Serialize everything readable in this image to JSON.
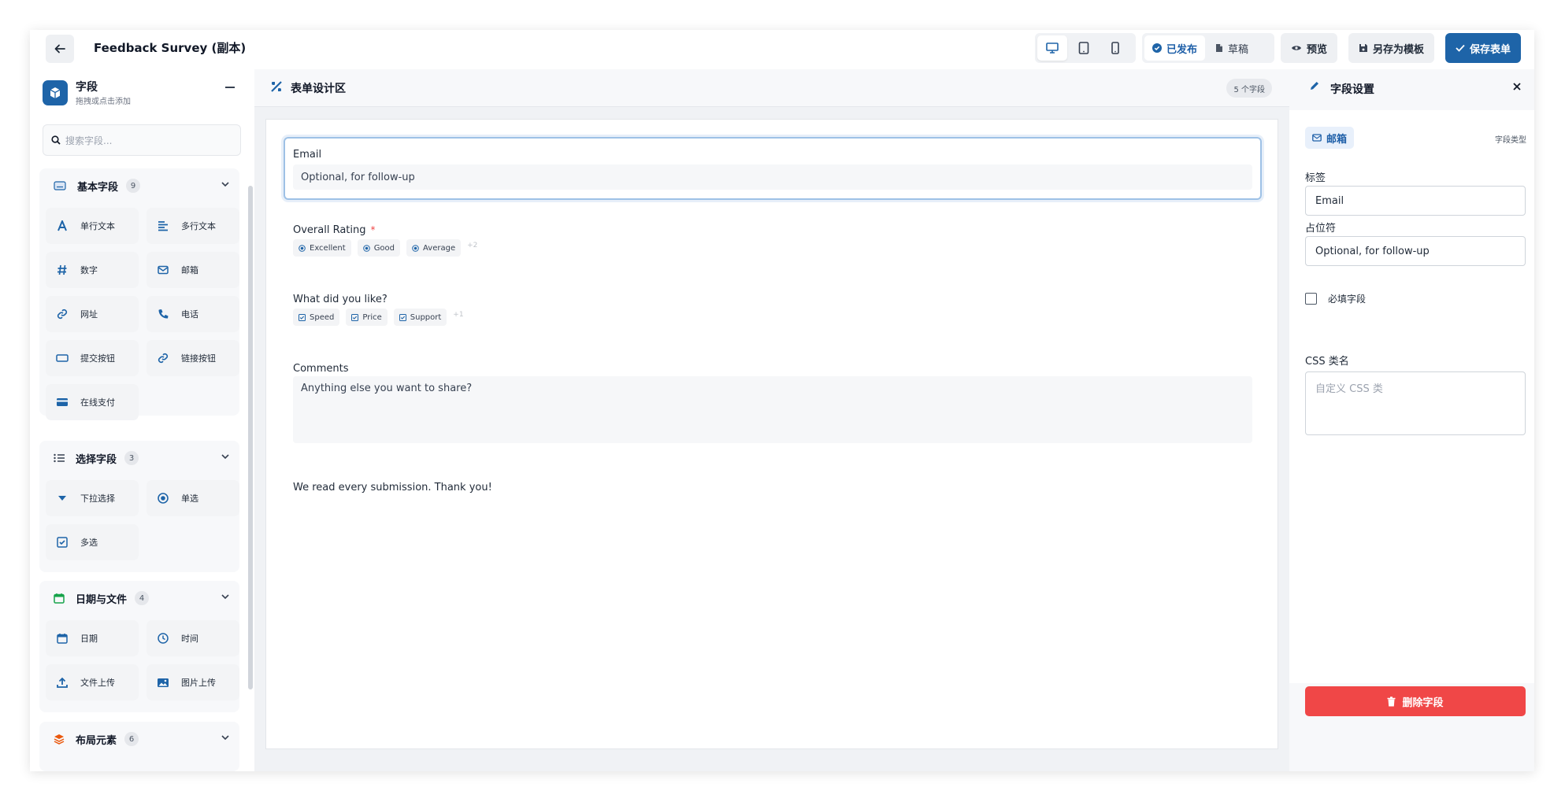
{
  "topbar": {
    "title": "Feedback Survey (副本)",
    "status_published": "已发布",
    "status_draft": "草稿",
    "preview_label": "预览",
    "save_template_label": "另存为模板",
    "save_form_label": "保存表单"
  },
  "sidebar": {
    "title": "字段",
    "subtitle": "拖拽或点击添加",
    "search_placeholder": "搜索字段...",
    "groups": [
      {
        "title": "基本字段",
        "count": "9",
        "items": [
          "单行文本",
          "多行文本",
          "数字",
          "邮箱",
          "网址",
          "电话",
          "提交按钮",
          "链接按钮",
          "在线支付"
        ]
      },
      {
        "title": "选择字段",
        "count": "3",
        "items": [
          "下拉选择",
          "单选",
          "多选"
        ]
      },
      {
        "title": "日期与文件",
        "count": "4",
        "items": [
          "日期",
          "时间",
          "文件上传",
          "图片上传"
        ]
      },
      {
        "title": "布局元素",
        "count": "6",
        "items": []
      }
    ]
  },
  "main": {
    "title": "表单设计区",
    "field_count": "5 个字段",
    "fields": {
      "email": {
        "label": "Email",
        "placeholder": "Optional, for follow-up"
      },
      "rating": {
        "label": "Overall Rating",
        "required_mark": "*",
        "options": [
          "Excellent",
          "Good",
          "Average"
        ],
        "more": "+2"
      },
      "liked": {
        "label": "What did you like?",
        "options": [
          "Speed",
          "Price",
          "Support"
        ],
        "more": "+1"
      },
      "comments": {
        "label": "Comments",
        "placeholder": "Anything else you want to share?"
      },
      "paragraph": {
        "text": "We read every submission. Thank you!"
      }
    }
  },
  "settings": {
    "title": "字段设置",
    "type_badge": "邮箱",
    "type_caption": "字段类型",
    "label_caption": "标签",
    "label_value": "Email",
    "placeholder_caption": "占位符",
    "placeholder_value": "Optional, for follow-up",
    "required_caption": "必填字段",
    "required_checked": false,
    "css_caption": "CSS 类名",
    "css_placeholder": "自定义 CSS 类",
    "delete_label": "删除字段"
  },
  "colors": {
    "primary": "#1e64a8",
    "danger": "#f04747",
    "selected_border": "#9ec1e6"
  }
}
